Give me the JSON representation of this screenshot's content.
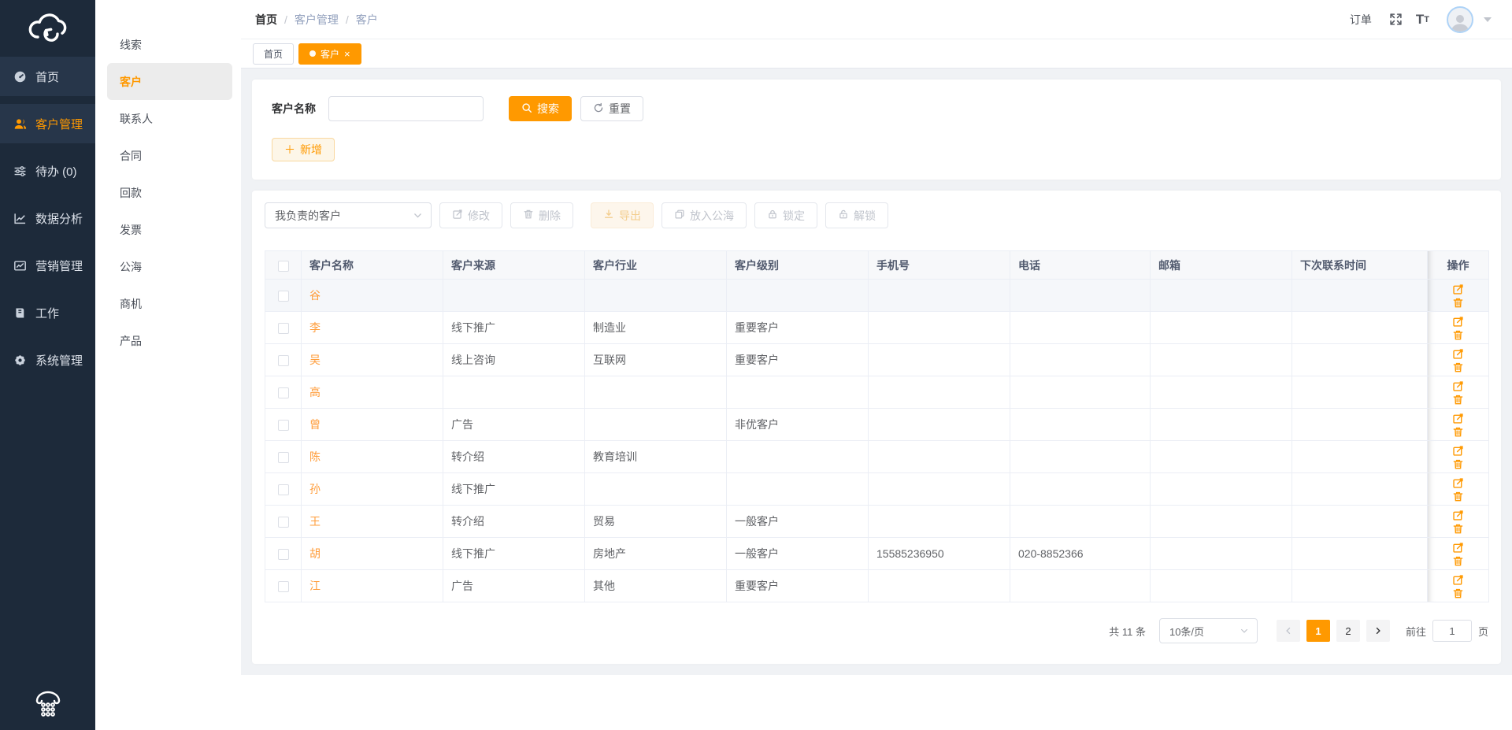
{
  "theme": {
    "accent": "#ff9900",
    "sidebar_bg": "#1d2a3a",
    "link_color": "#ff9c39",
    "content_bg": "#f0f2f5"
  },
  "sidebar": {
    "logo_icon": "cloud-sync-logo",
    "items": [
      {
        "label": "首页",
        "icon": "dashboard-icon",
        "active": false
      },
      {
        "label": "客户管理",
        "icon": "users-icon",
        "active": true
      },
      {
        "label": "待办 (0)",
        "icon": "sliders-icon",
        "active": false
      },
      {
        "label": "数据分析",
        "icon": "line-chart-icon",
        "active": false
      },
      {
        "label": "营销管理",
        "icon": "marketing-chart-icon",
        "active": false
      },
      {
        "label": "工作",
        "icon": "notebook-icon",
        "active": false
      },
      {
        "label": "系统管理",
        "icon": "gear-icon",
        "active": false
      }
    ],
    "phone_icon": "telephone-icon"
  },
  "submenu": {
    "items": [
      {
        "label": "线索",
        "active": false
      },
      {
        "label": "客户",
        "active": true
      },
      {
        "label": "联系人",
        "active": false
      },
      {
        "label": "合同",
        "active": false
      },
      {
        "label": "回款",
        "active": false
      },
      {
        "label": "发票",
        "active": false
      },
      {
        "label": "公海",
        "active": false
      },
      {
        "label": "商机",
        "active": false
      },
      {
        "label": "产品",
        "active": false
      }
    ]
  },
  "header": {
    "breadcrumb": [
      "首页",
      "客户管理",
      "客户"
    ],
    "order_label": "订单",
    "icons": [
      "fullscreen-icon",
      "font-size-icon",
      "avatar",
      "caret-down-icon"
    ]
  },
  "tabs": [
    {
      "label": "首页",
      "active": false,
      "closable": false
    },
    {
      "label": "客户",
      "active": true,
      "closable": true
    }
  ],
  "search": {
    "label": "客户名称",
    "value": "",
    "search_label": "搜索",
    "reset_label": "重置",
    "add_label": "新增"
  },
  "toolbar": {
    "scope_select_value": "我负责的客户",
    "buttons": [
      {
        "label": "修改",
        "icon": "edit-icon",
        "disabled": true
      },
      {
        "label": "删除",
        "icon": "trash-icon",
        "disabled": true
      },
      {
        "label": "导出",
        "icon": "download-icon",
        "disabled": true,
        "style": "export"
      },
      {
        "label": "放入公海",
        "icon": "move-to-sea-icon",
        "disabled": true
      },
      {
        "label": "锁定",
        "icon": "lock-icon",
        "disabled": true
      },
      {
        "label": "解锁",
        "icon": "unlock-icon",
        "disabled": true
      }
    ]
  },
  "table": {
    "columns": [
      "",
      "客户名称",
      "客户来源",
      "客户行业",
      "客户级别",
      "手机号",
      "电话",
      "邮箱",
      "下次联系时间",
      "操作"
    ],
    "rows": [
      {
        "name": "谷",
        "source": "",
        "industry": "",
        "level": "",
        "mobile": "",
        "phone": "",
        "email": "",
        "next_time": "",
        "highlighted": true
      },
      {
        "name": "李",
        "source": "线下推广",
        "industry": "制造业",
        "level": "重要客户",
        "mobile": "",
        "phone": "",
        "email": "",
        "next_time": "",
        "highlighted": false
      },
      {
        "name": "吴",
        "source": "线上咨询",
        "industry": "互联网",
        "level": "重要客户",
        "mobile": "",
        "phone": "",
        "email": "",
        "next_time": "",
        "highlighted": false
      },
      {
        "name": "高",
        "source": "",
        "industry": "",
        "level": "",
        "mobile": "",
        "phone": "",
        "email": "",
        "next_time": "",
        "highlighted": false
      },
      {
        "name": "曾",
        "source": "广告",
        "industry": "",
        "level": "非优客户",
        "mobile": "",
        "phone": "",
        "email": "",
        "next_time": "",
        "highlighted": false
      },
      {
        "name": "陈",
        "source": "转介绍",
        "industry": "教育培训",
        "level": "",
        "mobile": "",
        "phone": "",
        "email": "",
        "next_time": "",
        "highlighted": false
      },
      {
        "name": "孙",
        "source": "线下推广",
        "industry": "",
        "level": "",
        "mobile": "",
        "phone": "",
        "email": "",
        "next_time": "",
        "highlighted": false
      },
      {
        "name": "王",
        "source": "转介绍",
        "industry": "贸易",
        "level": "一般客户",
        "mobile": "",
        "phone": "",
        "email": "",
        "next_time": "",
        "highlighted": false
      },
      {
        "name": "胡",
        "source": "线下推广",
        "industry": "房地产",
        "level": "一般客户",
        "mobile": "15585236950",
        "phone": "020-8852366",
        "email": "",
        "next_time": "",
        "highlighted": false
      },
      {
        "name": "江",
        "source": "广告",
        "industry": "其他",
        "level": "重要客户",
        "mobile": "",
        "phone": "",
        "email": "",
        "next_time": "",
        "highlighted": false
      }
    ],
    "row_actions": [
      "edit-icon",
      "delete-icon"
    ]
  },
  "pagination": {
    "total_label": "共 11 条",
    "page_size_value": "10条/页",
    "pages": [
      "1",
      "2"
    ],
    "current_page": "1",
    "goto_label": "前往",
    "goto_value": "1",
    "page_unit_label": "页"
  }
}
